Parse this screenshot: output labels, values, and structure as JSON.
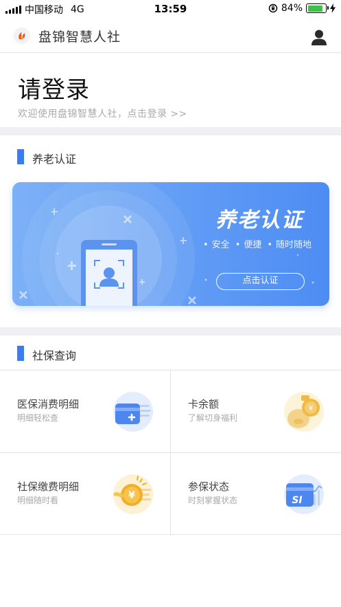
{
  "status_bar": {
    "carrier": "中国移动",
    "network": "4G",
    "time": "13:59",
    "battery": "84%",
    "battery_level": 0.84
  },
  "header": {
    "title": "盘锦智慧人社"
  },
  "login": {
    "title": "请登录",
    "subtitle": "欢迎使用盘锦智慧人社，点击登录  >>"
  },
  "pension": {
    "section_label": "养老认证",
    "banner_title": "养老认证",
    "features": [
      "安全",
      "便捷",
      "随时随地"
    ],
    "button_label": "点击认证"
  },
  "social": {
    "section_label": "社保查询",
    "tiles": [
      {
        "title": "医保消费明细",
        "subtitle": "明细轻松查",
        "icon": "medical-card-icon"
      },
      {
        "title": "卡余额",
        "subtitle": "了解切身福利",
        "icon": "coin-balance-icon"
      },
      {
        "title": "社保缴费明细",
        "subtitle": "明细随时看",
        "icon": "yuan-coin-icon"
      },
      {
        "title": "参保状态",
        "subtitle": "时刻掌握状态",
        "icon": "si-card-icon"
      }
    ]
  },
  "colors": {
    "accent": "#3b7cf3",
    "banner_start": "#7cb1f7",
    "banner_end": "#4d8cf3",
    "battery_green": "#3cc24a"
  }
}
